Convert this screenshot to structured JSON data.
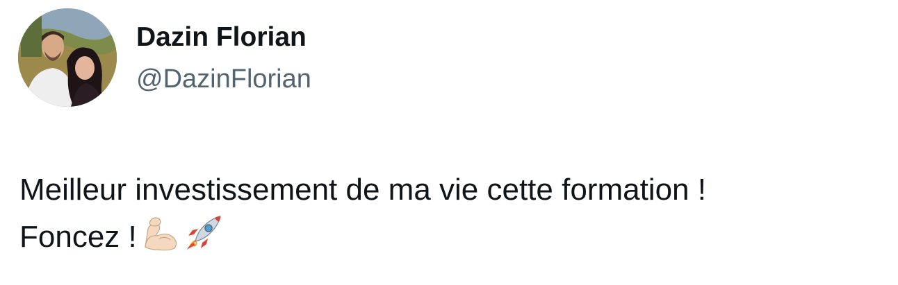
{
  "author": {
    "display_name": "Dazin Florian",
    "handle": "@DazinFlorian",
    "avatar_icon": "profile-photo"
  },
  "tweet": {
    "line1": "Meilleur investissement de ma vie cette formation !",
    "line2": "Foncez !",
    "emojis": [
      "flexed-biceps-icon",
      "rocket-icon"
    ]
  }
}
